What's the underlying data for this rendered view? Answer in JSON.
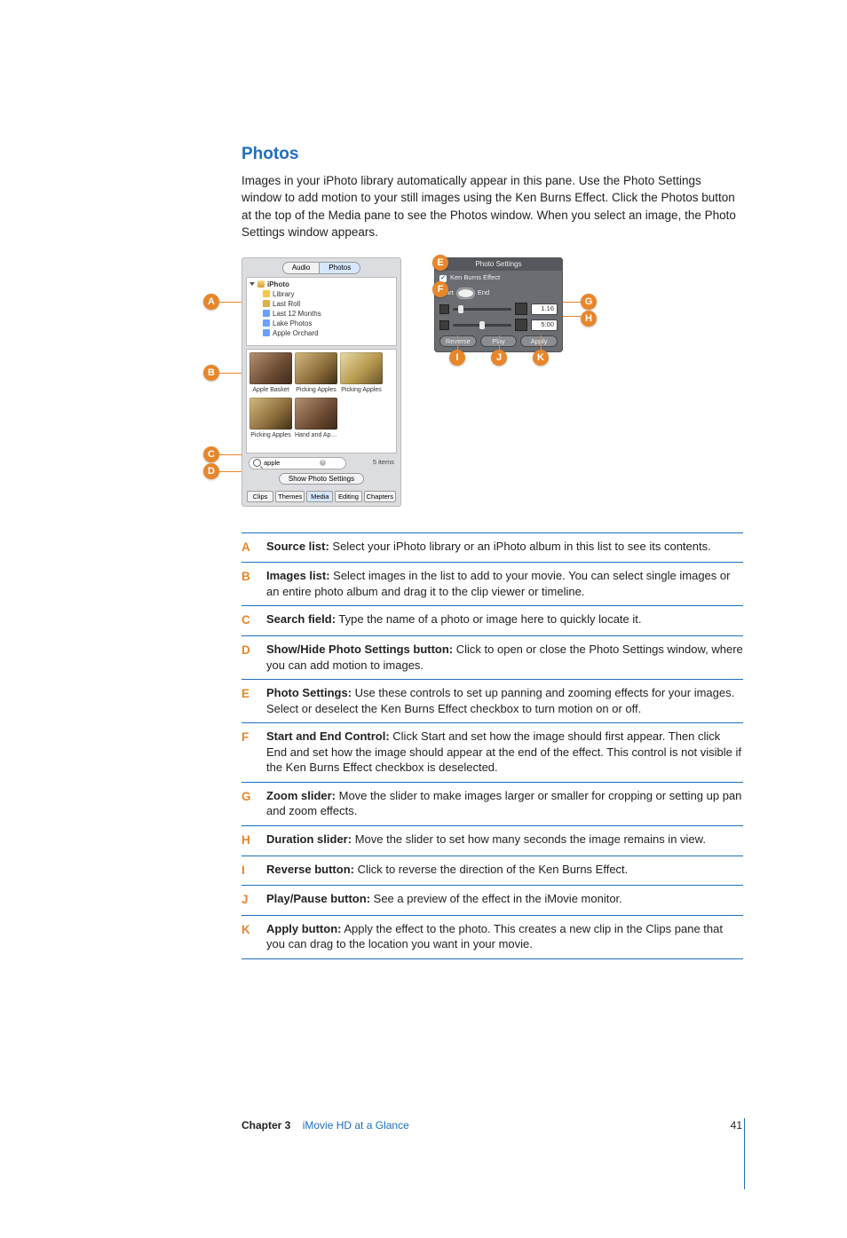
{
  "heading": "Photos",
  "intro": "Images in your iPhoto library automatically appear in this pane. Use the Photo Settings window to add motion to your still images using the Ken Burns Effect. Click the Photos button at the top of the Media pane to see the Photos window. When you select an image, the Photo Settings window appears.",
  "media_pane": {
    "seg": [
      "Audio",
      "Photos"
    ],
    "source": {
      "root": "iPhoto",
      "items": [
        "Library",
        "Last Roll",
        "Last 12 Months",
        "Lake Photos",
        "Apple Orchard"
      ]
    },
    "thumbs": [
      "Apple Basket",
      "Picking Apples",
      "Picking Apples",
      "Picking Apples",
      "Hand and Apple"
    ],
    "search_value": "apple",
    "count": "5 items",
    "show_button": "Show Photo Settings",
    "tabs": [
      "Clips",
      "Themes",
      "Media",
      "Editing",
      "Chapters"
    ]
  },
  "settings": {
    "title": "Photo Settings",
    "kbe_label": "Ken Burns Effect",
    "start": "Start",
    "end": "End",
    "zoom_value": "1.16",
    "duration_value": "5:00",
    "buttons": [
      "Reverse",
      "Play",
      "Apply"
    ]
  },
  "callouts": [
    "A",
    "B",
    "C",
    "D",
    "E",
    "F",
    "G",
    "H",
    "I",
    "J",
    "K"
  ],
  "defs": [
    {
      "l": "A",
      "t": "Source list:",
      "d": "  Select your iPhoto library or an iPhoto album in this list to see its contents."
    },
    {
      "l": "B",
      "t": "Images list:",
      "d": "  Select images in the list to add to your movie. You can select single images or an entire photo album and drag it to the clip viewer or timeline."
    },
    {
      "l": "C",
      "t": "Search field:",
      "d": "  Type the name of a photo or image here to quickly locate it."
    },
    {
      "l": "D",
      "t": "Show/Hide Photo Settings button:",
      "d": "  Click to open or close the Photo Settings window, where you can add motion to images."
    },
    {
      "l": "E",
      "t": "Photo Settings:",
      "d": "  Use these controls to set up panning and zooming effects for your images. Select or deselect the Ken Burns Effect checkbox to turn motion on or off."
    },
    {
      "l": "F",
      "t": "Start and End Control:",
      "d": "  Click Start and set how the image should first appear. Then click End and set how the image should appear at the end of the effect. This control is not visible if the Ken Burns Effect checkbox is deselected."
    },
    {
      "l": "G",
      "t": "Zoom slider:",
      "d": "  Move the slider to make images larger or smaller for cropping or setting up pan and zoom effects."
    },
    {
      "l": "H",
      "t": "Duration slider:",
      "d": "  Move the slider to set how many seconds the image remains in view."
    },
    {
      "l": "I",
      "t": "Reverse button:",
      "d": "  Click to reverse the direction of the Ken Burns Effect."
    },
    {
      "l": "J",
      "t": "Play/Pause button:",
      "d": "  See a preview of the effect in the iMovie monitor."
    },
    {
      "l": "K",
      "t": "Apply button:",
      "d": "  Apply the effect to the photo. This creates a new clip in the Clips pane that you can drag to the location you want in your movie."
    }
  ],
  "footer": {
    "chapter": "Chapter 3",
    "title": "iMovie HD at a Glance",
    "page": "41"
  }
}
